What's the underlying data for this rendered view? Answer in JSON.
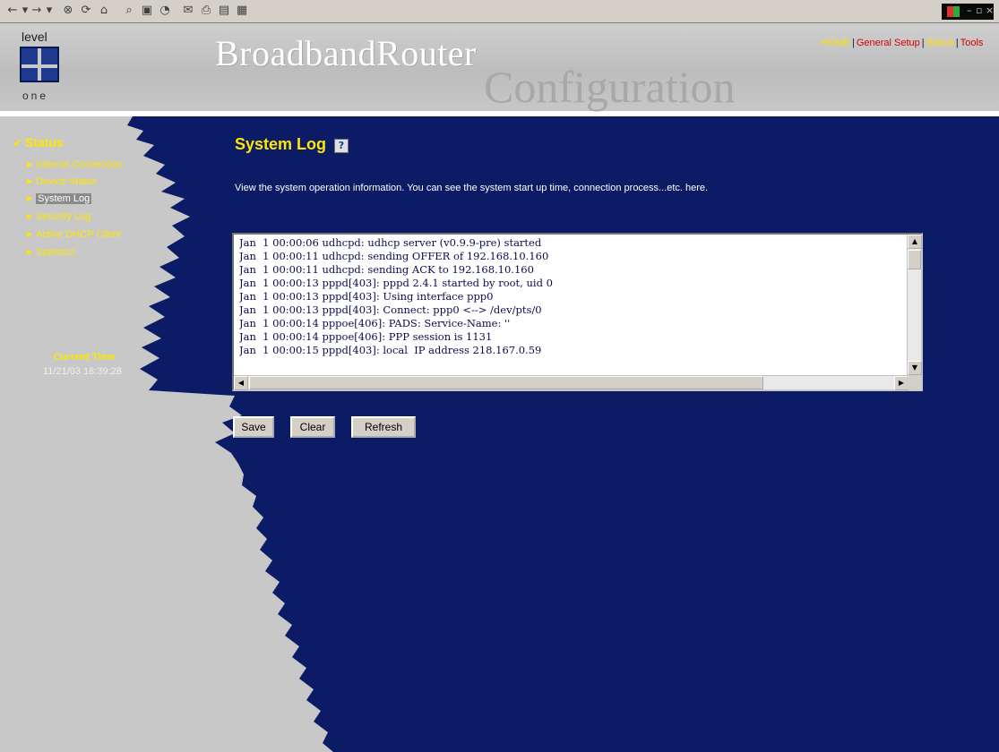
{
  "browser": {
    "toolbar_icons": [
      "back-icon",
      "forward-icon",
      "stop-icon",
      "refresh-icon",
      "home-icon",
      "search-icon",
      "favorites-icon",
      "history-icon",
      "mail-icon",
      "print-icon",
      "edit-icon",
      "messenger-icon"
    ]
  },
  "header": {
    "logo_top": "level",
    "logo_bottom": "one",
    "title_main": "BroadbandRouter",
    "title_sub": "Configuration",
    "nav": {
      "home": "HOME",
      "general_setup": "General Setup",
      "status": "Status",
      "tools": "Tools",
      "separator": "|"
    }
  },
  "sidebar": {
    "title": "Status",
    "items": [
      {
        "label": "Internet Connection"
      },
      {
        "label": "Device Status"
      },
      {
        "label": "System Log"
      },
      {
        "label": "Security Log"
      },
      {
        "label": "Active DHCP Client"
      },
      {
        "label": "Statistics"
      }
    ],
    "current_time_label": "Current Time",
    "current_time_value": "11/21/03 18:39:28"
  },
  "main": {
    "title": "System Log",
    "description": "View the system operation information. You can see the system start up time, connection process...etc. here.",
    "log_lines": [
      "Jan  1 00:00:06 udhcpd: udhcp server (v0.9.9-pre) started",
      "Jan  1 00:00:11 udhcpd: sending OFFER of 192.168.10.160",
      "Jan  1 00:00:11 udhcpd: sending ACK to 192.168.10.160",
      "Jan  1 00:00:13 pppd[403]: pppd 2.4.1 started by root, uid 0",
      "Jan  1 00:00:13 pppd[403]: Using interface ppp0",
      "Jan  1 00:00:13 pppd[403]: Connect: ppp0 <--> /dev/pts/0",
      "Jan  1 00:00:14 pppoe[406]: PADS: Service-Name: ''",
      "Jan  1 00:00:14 pppoe[406]: PPP session is 1131",
      "Jan  1 00:00:15 pppd[403]: local  IP address 218.167.0.59"
    ],
    "buttons": {
      "save": "Save",
      "clear": "Clear",
      "refresh": "Refresh"
    }
  },
  "colors": {
    "background_blue": "#0c1b66",
    "sidebar_gray": "#c8c8c8",
    "accent_yellow": "#ffe600",
    "nav_red": "#d20000"
  }
}
